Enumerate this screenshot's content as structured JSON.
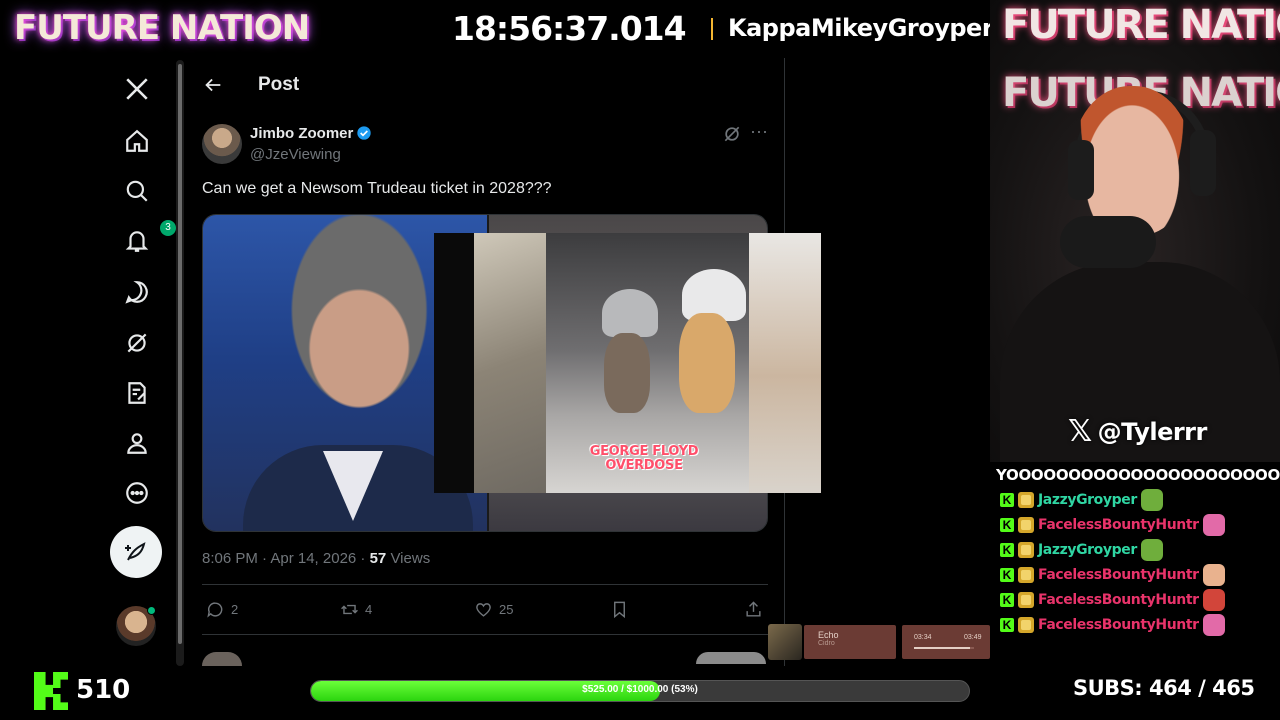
{
  "overlay": {
    "brand": "FUTURE NATION",
    "clock": "18:56:37.014",
    "channel": "KappaMikeyGroyper",
    "cam_banner": "FUTURE NATION",
    "x_handle": "@Tylerrr",
    "viewer_count": "510",
    "subs_label": "SUBS:",
    "subs_value": "464 / 465",
    "goal_text": "$525.00 / $1000.00 (53%)",
    "goal_fraction": 0.53,
    "kick_color": "#53fc18"
  },
  "nav": {
    "items": [
      "x-logo",
      "home",
      "explore",
      "notifications",
      "messages",
      "grok",
      "communities",
      "profile",
      "more"
    ],
    "notification_count": "3"
  },
  "post": {
    "header_title": "Post",
    "author_name": "Jimbo Zoomer",
    "author_handle": "@JzeViewing",
    "text": "Can we get a Newsom Trudeau ticket in 2028???",
    "meta_time": "8:06 PM · Apr 14, 2026 · ",
    "meta_views_count": "57",
    "meta_views_label": " Views",
    "replies": "2",
    "reposts": "4",
    "likes": "25"
  },
  "video_overlay": {
    "caption": "GEORGE FLOYD OVERDOSE"
  },
  "chat": {
    "long_message": "YOOOOOOOOOOOOOOOOOOOOOOOOOOOOO",
    "messages": [
      {
        "user": "JazzyGroyper",
        "color": "#2fd6a3"
      },
      {
        "user": "FacelessBountyHuntr",
        "color": "#e8336a"
      },
      {
        "user": "JazzyGroyper",
        "color": "#2fd6a3"
      },
      {
        "user": "FacelessBountyHuntr",
        "color": "#e8336a"
      },
      {
        "user": "FacelessBountyHuntr",
        "color": "#e8336a"
      },
      {
        "user": "FacelessBountyHuntr",
        "color": "#e8336a"
      }
    ]
  },
  "music": {
    "title": "Echo",
    "artist": "Cidro",
    "current": "03:34",
    "total": "03:49",
    "progress": 0.93
  }
}
